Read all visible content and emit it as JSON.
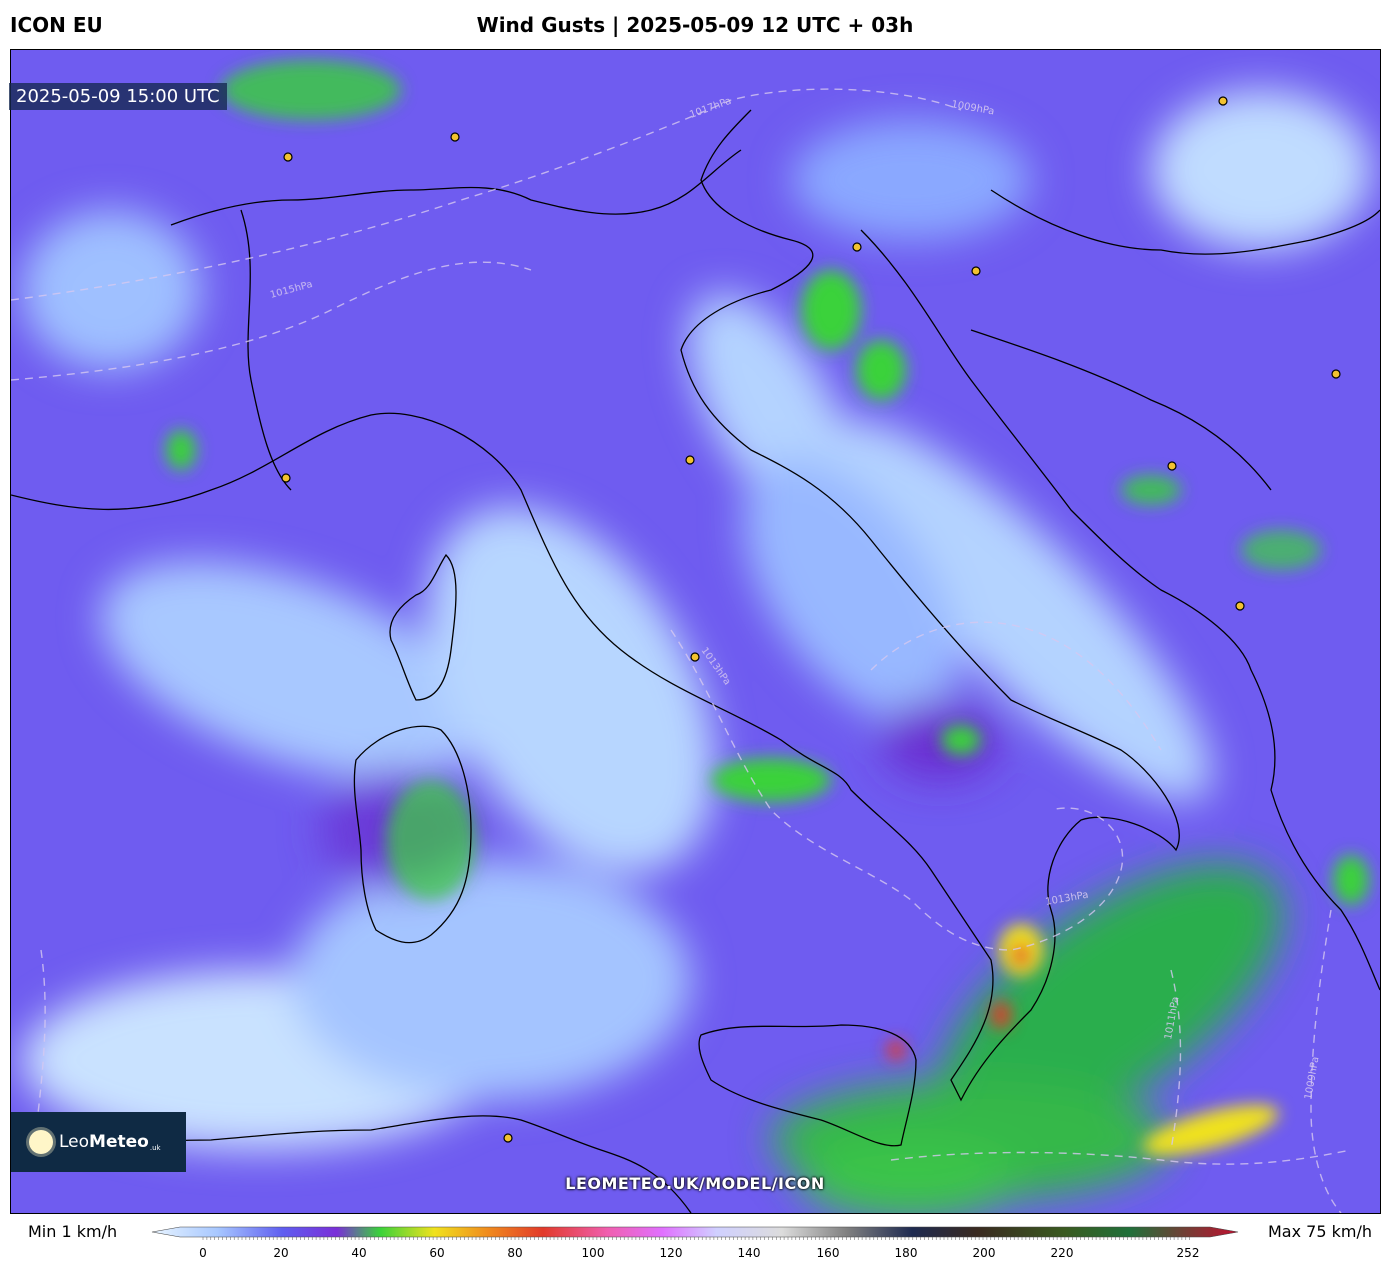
{
  "header": {
    "model": "ICON EU",
    "title": "Wind Gusts | 2025-05-09 12 UTC + 03h"
  },
  "map": {
    "valid_time": "2025-05-09 15:00 UTC",
    "watermark": "LEOMETEO.UK/MODEL/ICON",
    "isobar_labels": [
      "1017hPa",
      "1009hPa",
      "1013hPa",
      "1015hPa",
      "1011hPa"
    ],
    "colors": {
      "calm": "#cfe6ff",
      "light": "#8fb0ff",
      "moderate": "#6a55ee",
      "fresh": "#7a2fd8",
      "strong": "#3ad23a",
      "gale": "#f0e21e",
      "severe": "#e23a2a",
      "coast": "#000000",
      "isobar": "#d6c8f0"
    }
  },
  "logo": {
    "brand_light": "Leo",
    "brand_bold": "Meteo",
    "tld": ".uk"
  },
  "colorbar": {
    "min_label": "Min 1 km/h",
    "max_label": "Max 75 km/h",
    "ticks": [
      "0",
      "20",
      "40",
      "60",
      "80",
      "100",
      "120",
      "140",
      "160",
      "180",
      "200",
      "220",
      "252"
    ]
  }
}
